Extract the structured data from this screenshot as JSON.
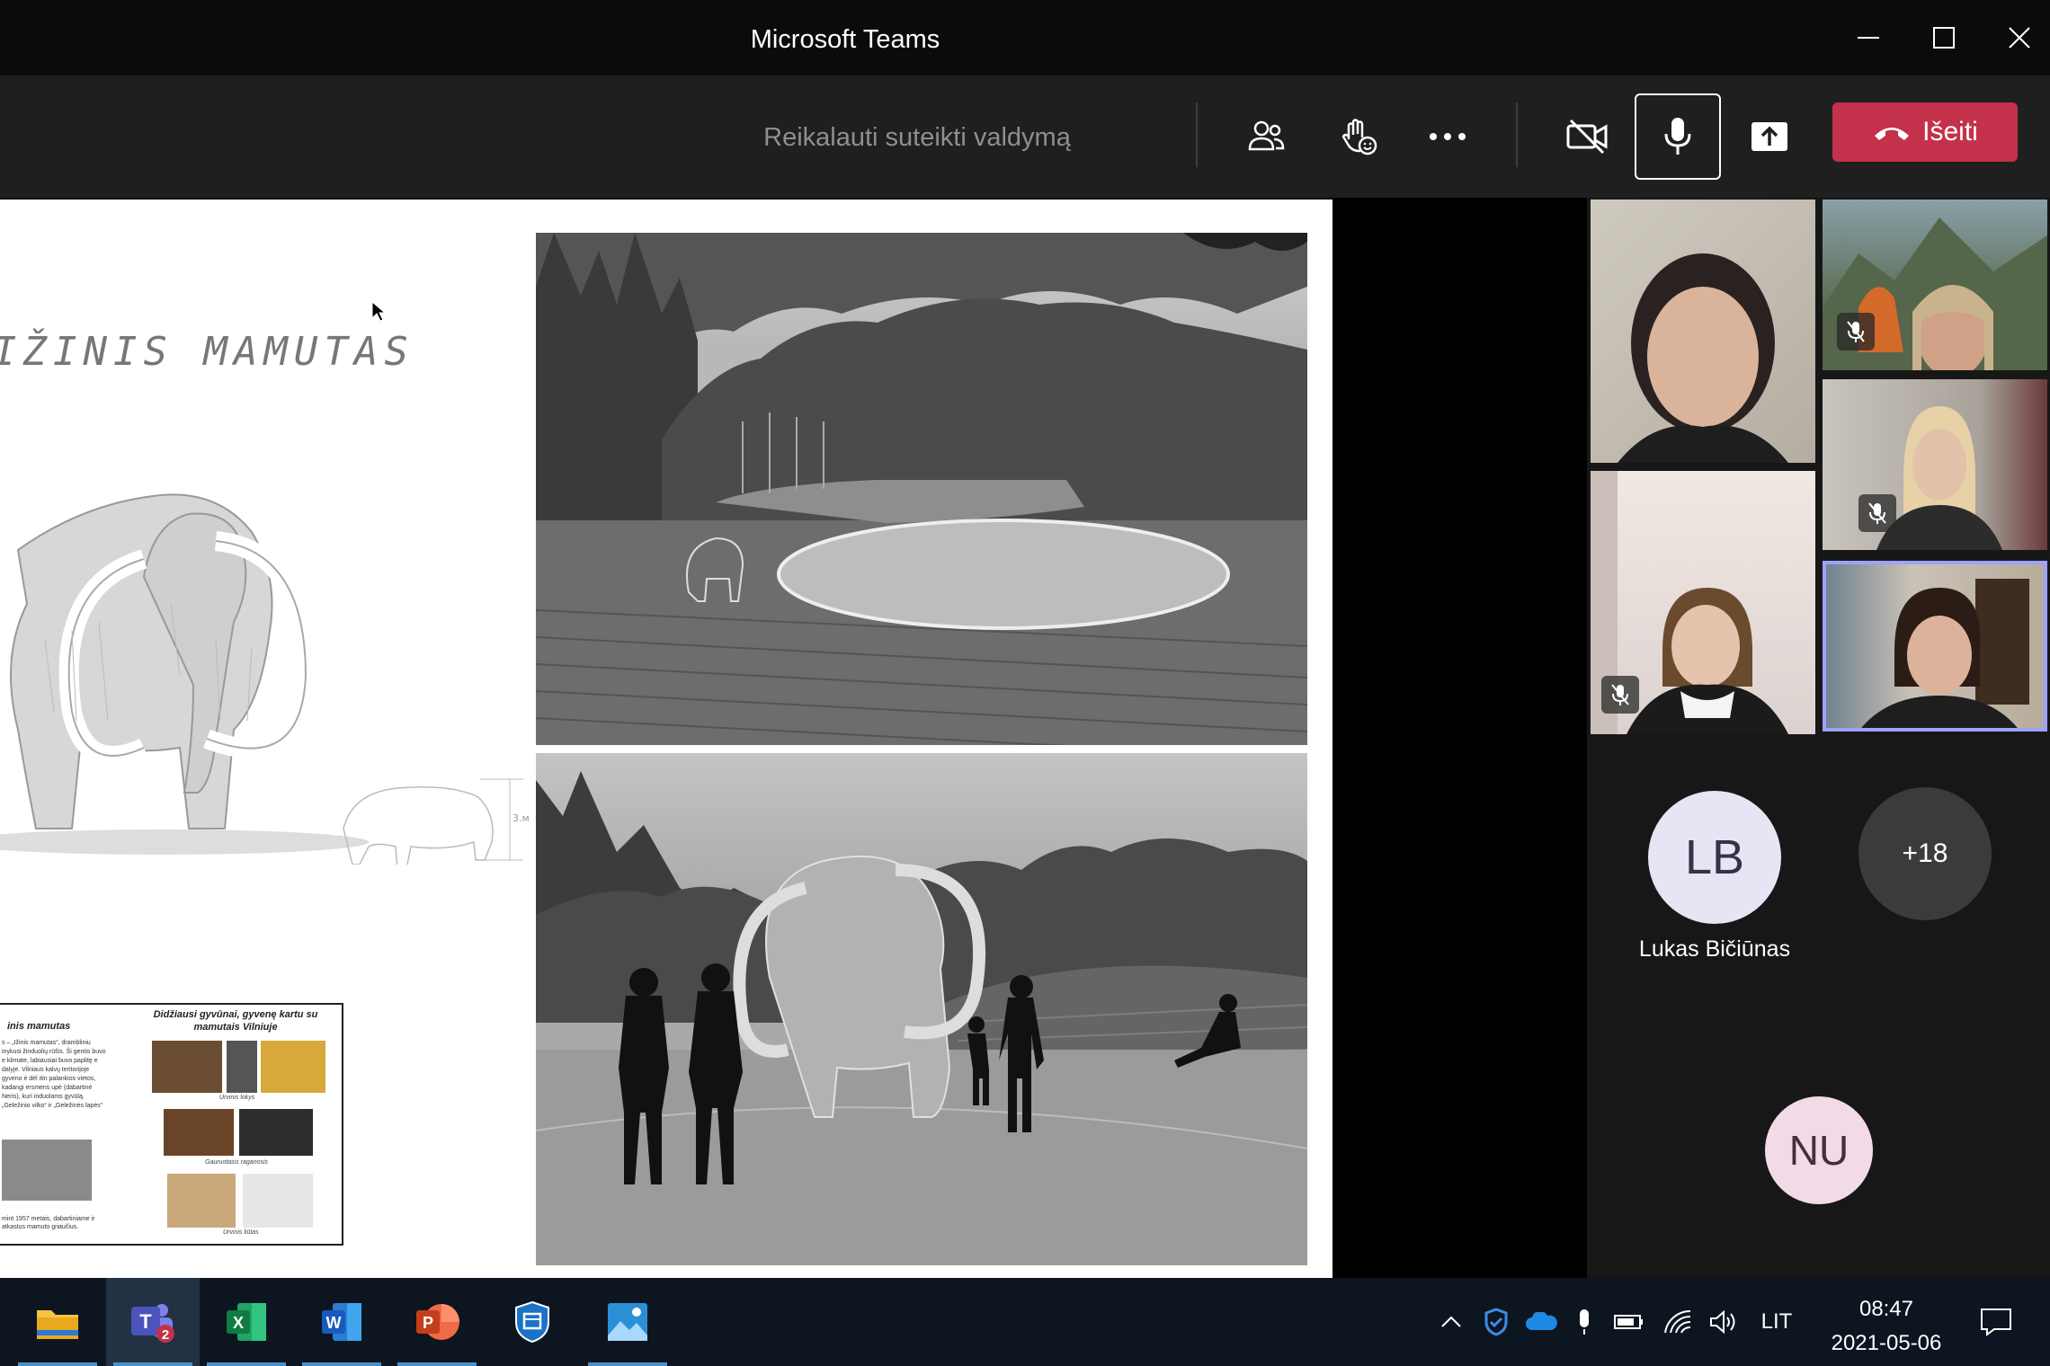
{
  "window": {
    "title": "Microsoft Teams"
  },
  "toolbar": {
    "request_control": "Reikalauti suteikti valdymą",
    "leave_label": "Išeiti",
    "leave_color": "#c4314b"
  },
  "slide": {
    "title": "IŽINIS MAMUTAS",
    "scale_label": "3.м",
    "poster": {
      "left_heading": "inis mamutas",
      "right_heading": "Didžiausi gyvūnai, gyvenę kartu su mamutais Vilniuje",
      "body_text": "s – „Ižinis mamutas“, drambliniu inykusi žinduolių rūšis. Ši gentis buvo e klimate, labiausiai buvo paplitę e dalyje. Vilniaus kalvų teritorijoje gyveno ė dėl itin palankios vietos, kadangi ersmens upė (dabartinė Neris), kuri induolams gyvūlą. „Geležinio vilko“ ir „Geležinės lapės“",
      "captions": [
        "Urvinis lokys",
        "Gauruotasis raganosis",
        "Urvinis liūtas"
      ],
      "footer_text": "mint 1957 metais, dabartiniame ir atkastus mamuto griaučius."
    }
  },
  "participants": {
    "named": [
      {
        "initials": "LB",
        "name": "Lukas Bičiūnas",
        "color": "#e8e4f4"
      }
    ],
    "overflow_label": "+18",
    "unnamed": {
      "initials": "NU",
      "color": "#f2dbe7"
    }
  },
  "taskbar": {
    "apps": [
      "file-explorer",
      "teams",
      "excel",
      "word",
      "powerpoint",
      "security",
      "photos"
    ],
    "teams_badge": "2",
    "language": "LIT",
    "time": "08:47",
    "date": "2021-05-06"
  }
}
